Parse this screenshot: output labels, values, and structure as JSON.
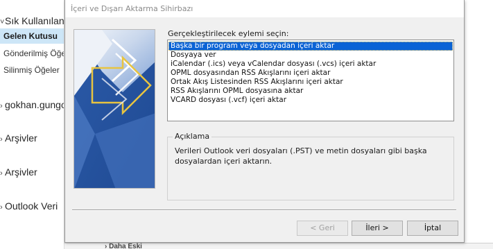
{
  "sidebar": {
    "favorites": "Sık Kullanılan",
    "inbox": "Gelen Kutusu",
    "sent": "Gönderilmiş Öğeler",
    "deleted": "Silinmiş Öğeler",
    "account": "gokhan.gungor",
    "archive1": "Arşivler",
    "archive2": "Arşivler",
    "outlook_data": "Outlook Veri"
  },
  "below": {
    "older": "Daha Eski"
  },
  "dialog": {
    "title": "İçeri ve Dışarı Aktarma Sihirbazı",
    "action_label": "Gerçekleştirilecek eylemi seçin:",
    "actions": [
      "Başka bir program veya dosyadan içeri aktar",
      "Dosyaya ver",
      "iCalendar (.ics) veya vCalendar dosyası (.vcs) içeri aktar",
      "OPML dosyasından RSS Akışlarını içeri aktar",
      "Ortak Akış Listesinden RSS Akışlarını içeri aktar",
      "RSS Akışlarını OPML dosyasına aktar",
      "VCARD dosyası (.vcf) içeri aktar"
    ],
    "selected_action_index": 0,
    "description_title": "Açıklama",
    "description": "Verileri Outlook veri dosyaları (.PST) ve metin dosyaları gibi başka dosyalardan içeri aktarın.",
    "buttons": {
      "back": "< Geri",
      "next": "İleri >",
      "cancel": "İptal"
    }
  },
  "colors": {
    "selection": "#0a63d6",
    "sidebar_selected": "#cde6f7",
    "dialog_bg": "#f0f0f0",
    "wizard_blue": "#2f63b6",
    "wizard_arrow": "#e8c440"
  }
}
